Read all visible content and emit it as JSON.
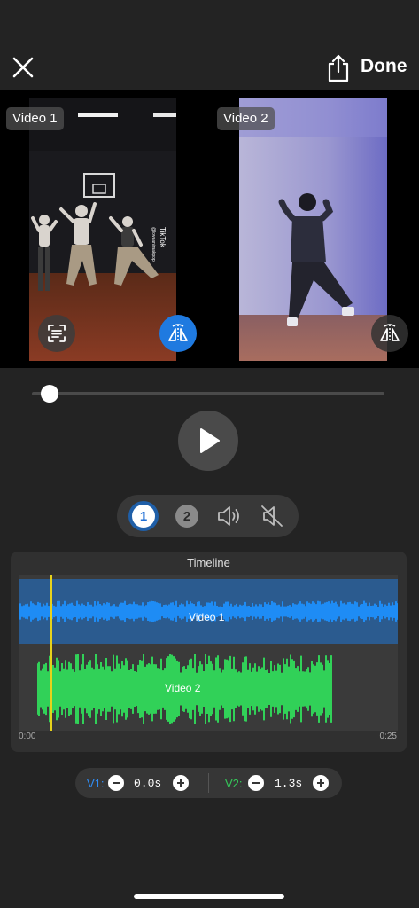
{
  "header": {
    "done_label": "Done"
  },
  "preview": {
    "video1_label": "Video 1",
    "video2_label": "Video 2",
    "watermark_brand": "TikTok",
    "watermark_handle": "@loveanimakpop"
  },
  "playback": {
    "progress": 0.05
  },
  "audio_selector": {
    "options": [
      "1",
      "2"
    ],
    "selected": "1"
  },
  "timeline": {
    "title": "Timeline",
    "track1_label": "Video 1",
    "track2_label": "Video 2",
    "start_time": "0:00",
    "end_time": "0:25"
  },
  "offsets": {
    "v1_label": "V1:",
    "v1_value": "0.0s",
    "v2_label": "V2:",
    "v2_value": "1.3s"
  },
  "colors": {
    "accent_blue": "#1f7ae0",
    "video1_wave": "#1e8cf5",
    "video2_wave": "#31d158",
    "playhead": "#e7d21b"
  }
}
